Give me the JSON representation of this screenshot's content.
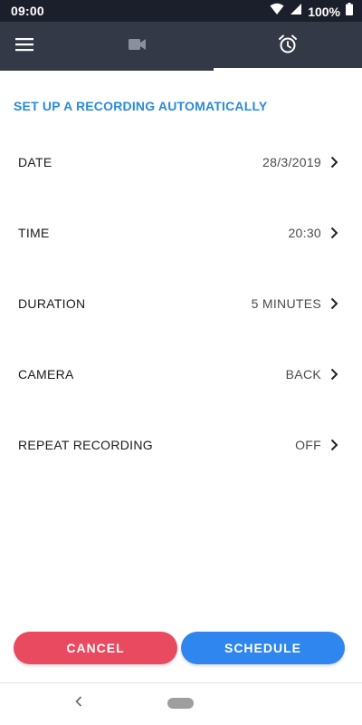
{
  "status_bar": {
    "time": "09:00",
    "battery": "100%",
    "icons": [
      "wifi-icon",
      "signal-icon",
      "battery-icon"
    ]
  },
  "app_bar": {
    "icons": [
      "menu-icon",
      "video-camera-icon",
      "alarm-clock-icon"
    ],
    "active_tab": "schedule"
  },
  "section": {
    "title": "SET UP A RECORDING AUTOMATICALLY"
  },
  "settings": [
    {
      "label": "DATE",
      "value": "28/3/2019"
    },
    {
      "label": "TIME",
      "value": "20:30"
    },
    {
      "label": "DURATION",
      "value": "5 MINUTES"
    },
    {
      "label": "CAMERA",
      "value": "BACK"
    },
    {
      "label": "REPEAT RECORDING",
      "value": "OFF"
    }
  ],
  "buttons": {
    "cancel": "CANCEL",
    "schedule": "SCHEDULE"
  },
  "colors": {
    "status_bar": "#1b1f2b",
    "app_bar": "#333947",
    "accent_text": "#2a8ad8",
    "cancel": "#e94a5f",
    "schedule": "#2f86ef"
  }
}
